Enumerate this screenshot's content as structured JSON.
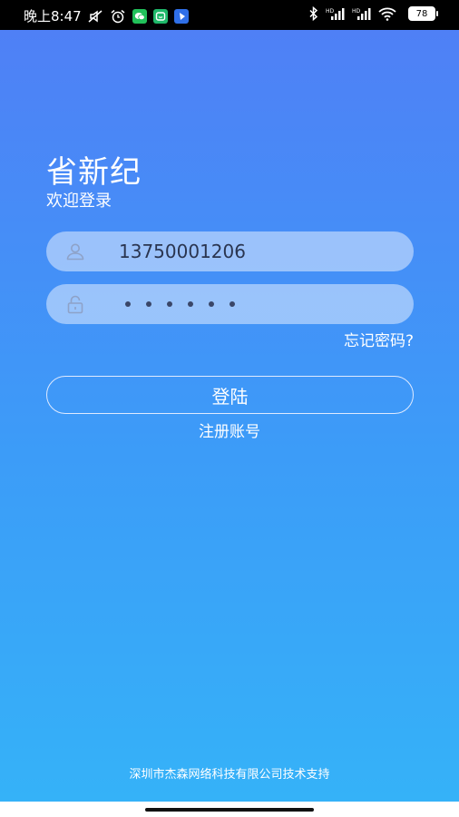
{
  "status_bar": {
    "time": "晚上8:47",
    "battery_level": "78",
    "network_label_1": "HD",
    "network_label_2": "HD",
    "left_icons": [
      "mute-icon",
      "alarm-icon",
      "wechat-icon",
      "app-icon",
      "feishu-icon"
    ],
    "right_icons": [
      "bluetooth-icon",
      "signal-icon",
      "signal-icon",
      "wifi-icon",
      "battery-icon"
    ]
  },
  "header": {
    "app_title": "省新纪",
    "welcome_text": "欢迎登录"
  },
  "login_form": {
    "username_value": "13750001206",
    "username_icon": "user-icon",
    "password_icon": "lock-icon",
    "password_mask_length": 6,
    "forgot_password_label": "忘记密码?",
    "login_button_label": "登陆",
    "register_label": "注册账号"
  },
  "footer": {
    "credit_text": "深圳市杰森网络科技有限公司技术支持"
  },
  "colors": {
    "gradient_top": "#4f80f6",
    "gradient_bottom": "#35b2f8",
    "field_background": "rgba(225,236,255,0.55)",
    "text_light": "#ffffff"
  }
}
